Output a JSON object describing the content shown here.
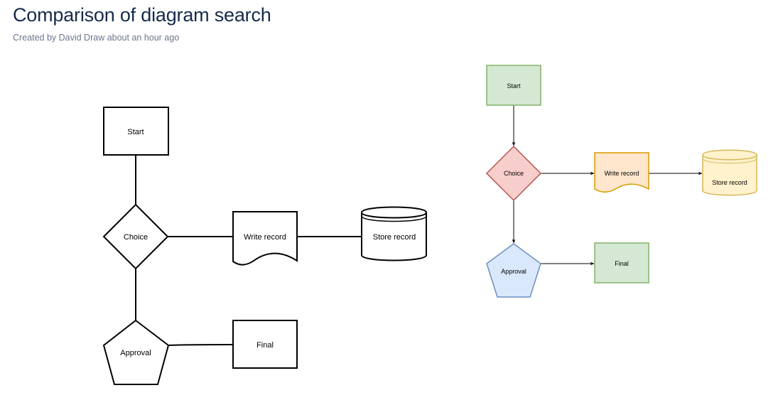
{
  "page": {
    "title": "Comparison of diagram search",
    "byline": "Created by David Draw about an hour ago"
  },
  "diagrams": {
    "plain": {
      "nodes": {
        "start": "Start",
        "choice": "Choice",
        "write": "Write record",
        "store": "Store record",
        "approval": "Approval",
        "final": "Final"
      },
      "stroke": "#000000",
      "fill": "#ffffff"
    },
    "colored": {
      "nodes": {
        "start": "Start",
        "choice": "Choice",
        "write": "Write record",
        "store": "Store record",
        "approval": "Approval",
        "final": "Final"
      },
      "colors": {
        "green_fill": "#d5e8d4",
        "green_stroke": "#82b366",
        "red_fill": "#f8cecc",
        "red_stroke": "#b85450",
        "orange_fill": "#ffe6cc",
        "orange_stroke": "#d79b00",
        "yellow_fill": "#fff2cc",
        "yellow_stroke": "#d6b656",
        "blue_fill": "#dae8fc",
        "blue_stroke": "#6c8ebf",
        "edge": "#000000"
      }
    }
  }
}
